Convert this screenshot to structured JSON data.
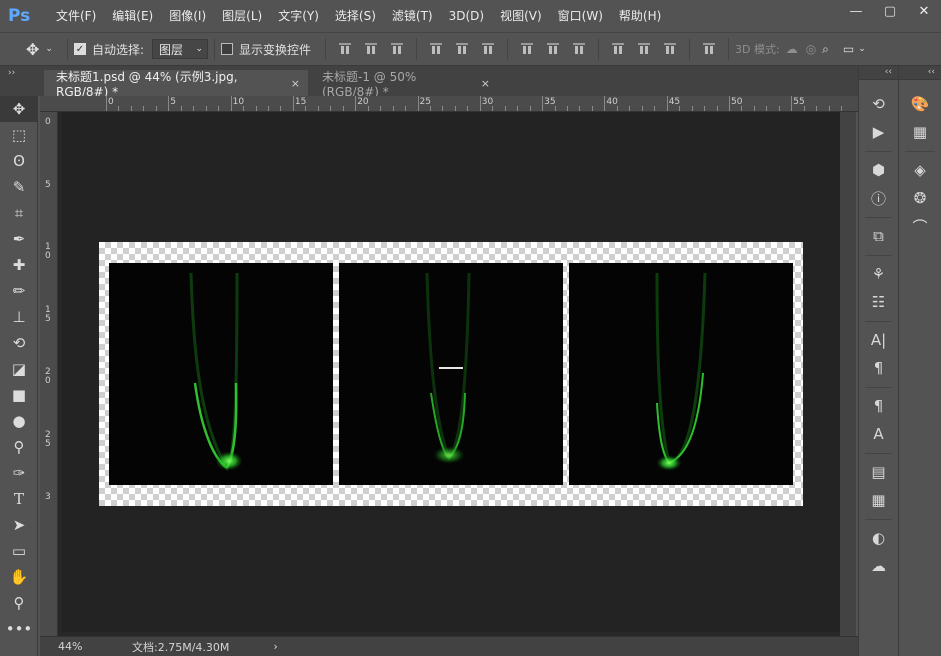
{
  "app": {
    "logo": "Ps"
  },
  "menu": [
    "文件(F)",
    "编辑(E)",
    "图像(I)",
    "图层(L)",
    "文字(Y)",
    "选择(S)",
    "滤镜(T)",
    "3D(D)",
    "视图(V)",
    "窗口(W)",
    "帮助(H)"
  ],
  "window": {
    "minimize": "—",
    "maximize": "▢",
    "close": "✕"
  },
  "options": {
    "auto_select_label": "自动选择:",
    "auto_select_checked": true,
    "auto_select_target": "图层",
    "show_transform_label": "显示变换控件",
    "show_transform_checked": false,
    "mode_3d_label": "3D 模式:"
  },
  "tabs": [
    {
      "title": "未标题1.psd @ 44% (示例3.jpg, RGB/8#) *",
      "active": true,
      "close": "×"
    },
    {
      "title": "未标题-1 @ 50%(RGB/8#) *",
      "active": false,
      "close": "×"
    }
  ],
  "ruler": {
    "top_labels": [
      "0",
      "5",
      "10",
      "15",
      "20",
      "25",
      "30",
      "35",
      "40",
      "45",
      "50",
      "55"
    ],
    "left_labels": [
      "0",
      "5",
      "1\n0",
      "1\n5",
      "2\n0",
      "2\n5",
      "3"
    ]
  },
  "status": {
    "zoom": "44%",
    "doc_size": "文档:2.75M/4.30M",
    "arrow": "›"
  },
  "colors": {
    "accent": "#5fa8ff",
    "glow": "#3bd43b"
  }
}
